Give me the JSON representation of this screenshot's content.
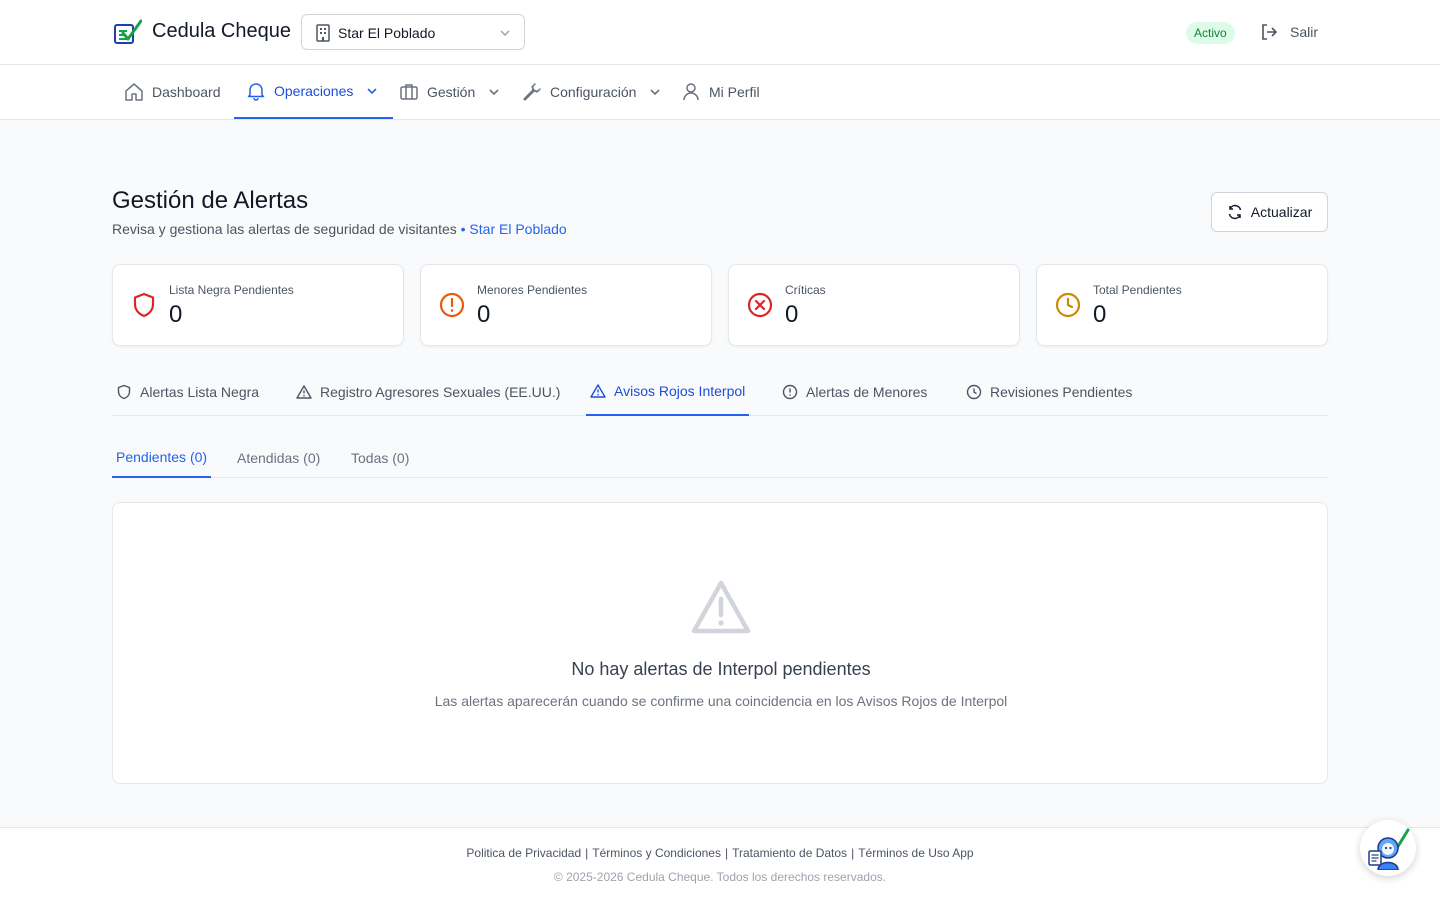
{
  "header": {
    "app_title": "Cedula Cheque",
    "site_selector": "Star El Poblado",
    "status_badge": "Activo",
    "logout_label": "Salir"
  },
  "nav": {
    "items": [
      {
        "label": "Dashboard",
        "icon": "home-icon"
      },
      {
        "label": "Operaciones",
        "icon": "bell-icon",
        "active": true
      },
      {
        "label": "Gestión",
        "icon": "briefcase-icon"
      },
      {
        "label": "Configuración",
        "icon": "wrench-icon"
      },
      {
        "label": "Mi Perfil",
        "icon": "user-icon"
      }
    ]
  },
  "page": {
    "title": "Gestión de Alertas",
    "subtitle": "Revisa y gestiona las alertas de seguridad de visitantes",
    "site_suffix": "• Star El Poblado",
    "refresh_label": "Actualizar"
  },
  "stats": [
    {
      "label": "Lista Negra Pendientes",
      "value": "0",
      "icon": "shield-icon",
      "color": "#dc2626"
    },
    {
      "label": "Menores Pendientes",
      "value": "0",
      "icon": "alert-circle-icon",
      "color": "#ea580c"
    },
    {
      "label": "Críticas",
      "value": "0",
      "icon": "x-circle-icon",
      "color": "#dc2626"
    },
    {
      "label": "Total Pendientes",
      "value": "0",
      "icon": "clock-icon",
      "color": "#ca8a04"
    }
  ],
  "tabs": [
    {
      "label": "Alertas Lista Negra",
      "icon": "shield-icon"
    },
    {
      "label": "Registro Agresores Sexuales (EE.UU.)",
      "icon": "triangle-alert-icon"
    },
    {
      "label": "Avisos Rojos Interpol",
      "icon": "triangle-alert-icon",
      "active": true
    },
    {
      "label": "Alertas de Menores",
      "icon": "alert-circle-icon"
    },
    {
      "label": "Revisiones Pendientes",
      "icon": "clock-icon"
    }
  ],
  "subtabs": [
    {
      "label": "Pendientes (0)",
      "active": true
    },
    {
      "label": "Atendidas (0)"
    },
    {
      "label": "Todas (0)"
    }
  ],
  "empty_state": {
    "title": "No hay alertas de Interpol pendientes",
    "message": "Las alertas aparecerán cuando se confirme una coincidencia en los Avisos Rojos de Interpol"
  },
  "footer": {
    "links": [
      "Politica de Privacidad",
      "Términos y Condiciones",
      "Tratamiento de Datos",
      "Términos de Uso App"
    ],
    "separator": "|",
    "copyright": "© 2025-2026 Cedula Cheque.  Todos los derechos reservados."
  },
  "colors": {
    "accent": "#2563eb",
    "active_badge_bg": "#dcfce7",
    "active_badge_text": "#15803d"
  }
}
